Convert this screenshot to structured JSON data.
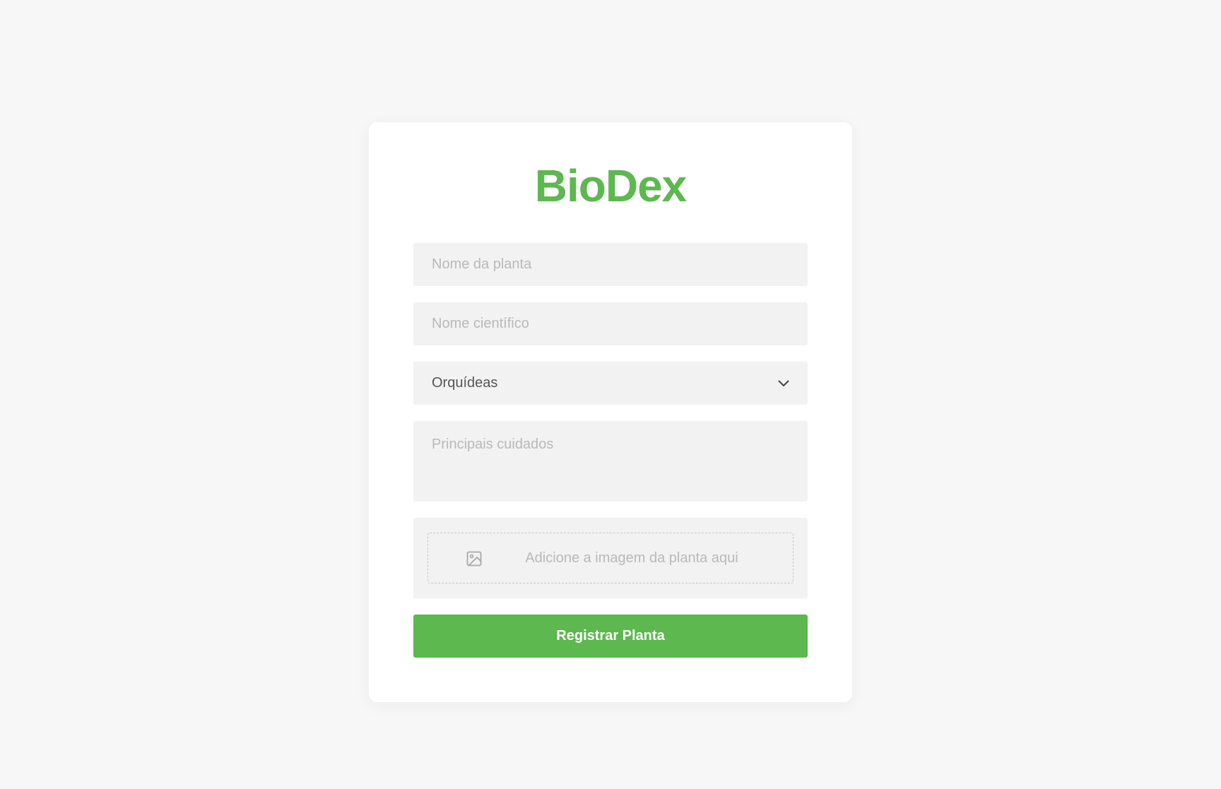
{
  "app": {
    "title": "BioDex",
    "accent_color": "#5cb84f"
  },
  "form": {
    "plant_name": {
      "value": "",
      "placeholder": "Nome da planta"
    },
    "scientific_name": {
      "value": "",
      "placeholder": "Nome científico"
    },
    "category": {
      "selected": "Orquídeas",
      "icon": "chevron-down-icon"
    },
    "care": {
      "value": "",
      "placeholder": "Principais cuidados"
    },
    "image_upload": {
      "label": "Adicione a imagem da planta aqui",
      "icon": "image-icon"
    },
    "submit_label": "Registrar Planta"
  }
}
